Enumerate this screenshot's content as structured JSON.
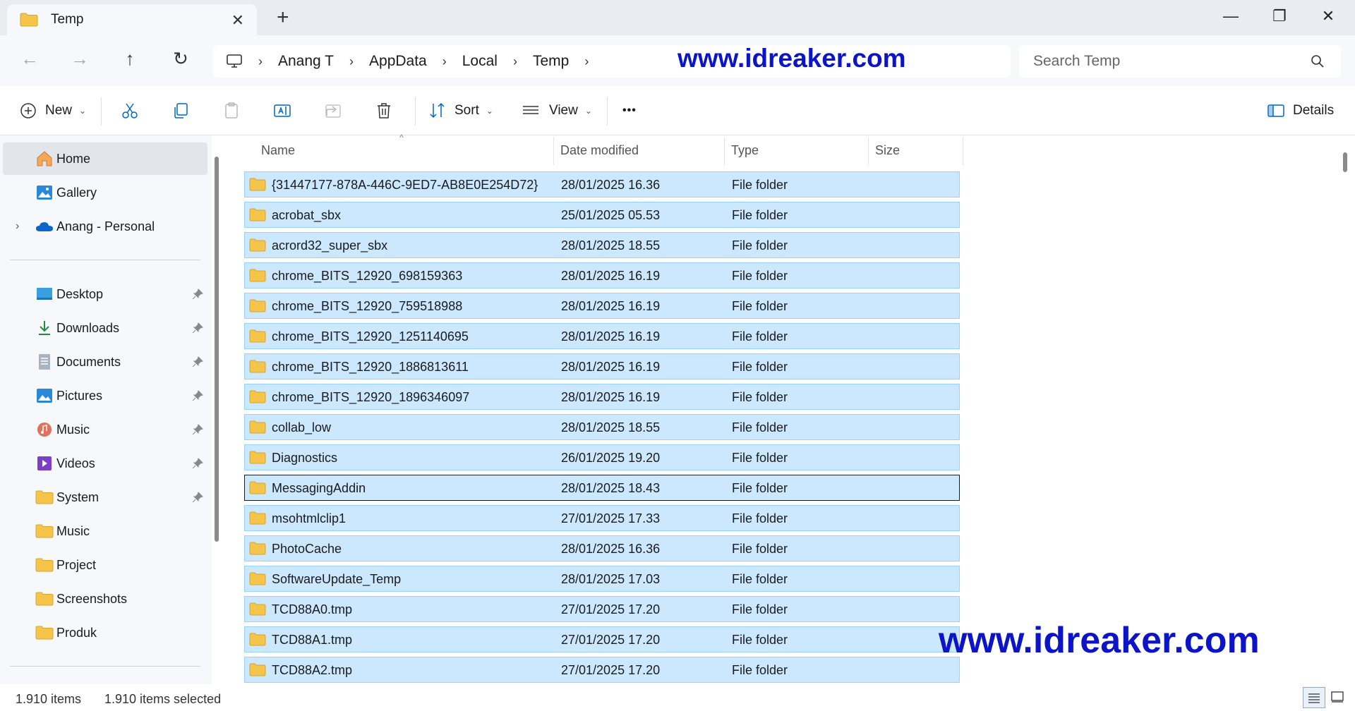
{
  "tab": {
    "title": "Temp",
    "close": "✕",
    "new": "+"
  },
  "window": {
    "minimize": "—",
    "restore": "❐",
    "close": "✕"
  },
  "nav": {
    "back": "←",
    "forward": "→",
    "up": "↑",
    "refresh": "↻"
  },
  "breadcrumb": [
    "Anang T",
    "AppData",
    "Local",
    "Temp"
  ],
  "breadcrumb_sep": "›",
  "watermark": "www.idreaker.com",
  "search": {
    "placeholder": "Search Temp"
  },
  "toolbar": {
    "new_label": "New",
    "sort_label": "Sort",
    "view_label": "View",
    "more_label": "•••",
    "details_label": "Details"
  },
  "sidebar": {
    "top": [
      {
        "label": "Home",
        "icon": "home-icon"
      },
      {
        "label": "Gallery",
        "icon": "gallery-icon"
      },
      {
        "label": "Anang - Personal",
        "icon": "onedrive-icon"
      }
    ],
    "quick": [
      {
        "label": "Desktop",
        "icon": "desktop-icon",
        "pinned": true
      },
      {
        "label": "Downloads",
        "icon": "downloads-icon",
        "pinned": true
      },
      {
        "label": "Documents",
        "icon": "documents-icon",
        "pinned": true
      },
      {
        "label": "Pictures",
        "icon": "pictures-icon",
        "pinned": true
      },
      {
        "label": "Music",
        "icon": "music-icon",
        "pinned": true
      },
      {
        "label": "Videos",
        "icon": "videos-icon",
        "pinned": true
      },
      {
        "label": "System",
        "icon": "folder-icon",
        "pinned": true
      },
      {
        "label": "Music",
        "icon": "folder-icon",
        "pinned": false
      },
      {
        "label": "Project",
        "icon": "folder-icon",
        "pinned": false
      },
      {
        "label": "Screenshots",
        "icon": "folder-icon",
        "pinned": false
      },
      {
        "label": "Produk",
        "icon": "folder-icon",
        "pinned": false
      }
    ]
  },
  "columns": {
    "name": "Name",
    "date": "Date modified",
    "type": "Type",
    "size": "Size"
  },
  "files": [
    {
      "name": "{31447177-878A-446C-9ED7-AB8E0E254D72}",
      "date": "28/01/2025 16.36",
      "type": "File folder"
    },
    {
      "name": "acrobat_sbx",
      "date": "25/01/2025 05.53",
      "type": "File folder"
    },
    {
      "name": "acrord32_super_sbx",
      "date": "28/01/2025 18.55",
      "type": "File folder"
    },
    {
      "name": "chrome_BITS_12920_698159363",
      "date": "28/01/2025 16.19",
      "type": "File folder"
    },
    {
      "name": "chrome_BITS_12920_759518988",
      "date": "28/01/2025 16.19",
      "type": "File folder"
    },
    {
      "name": "chrome_BITS_12920_1251140695",
      "date": "28/01/2025 16.19",
      "type": "File folder"
    },
    {
      "name": "chrome_BITS_12920_1886813611",
      "date": "28/01/2025 16.19",
      "type": "File folder"
    },
    {
      "name": "chrome_BITS_12920_1896346097",
      "date": "28/01/2025 16.19",
      "type": "File folder"
    },
    {
      "name": "collab_low",
      "date": "28/01/2025 18.55",
      "type": "File folder"
    },
    {
      "name": "Diagnostics",
      "date": "26/01/2025 19.20",
      "type": "File folder"
    },
    {
      "name": "MessagingAddin",
      "date": "28/01/2025 18.43",
      "type": "File folder",
      "focused": true
    },
    {
      "name": "msohtmlclip1",
      "date": "27/01/2025 17.33",
      "type": "File folder"
    },
    {
      "name": "PhotoCache",
      "date": "28/01/2025 16.36",
      "type": "File folder"
    },
    {
      "name": "SoftwareUpdate_Temp",
      "date": "28/01/2025 17.03",
      "type": "File folder"
    },
    {
      "name": "TCD88A0.tmp",
      "date": "27/01/2025 17.20",
      "type": "File folder"
    },
    {
      "name": "TCD88A1.tmp",
      "date": "27/01/2025 17.20",
      "type": "File folder"
    },
    {
      "name": "TCD88A2.tmp",
      "date": "27/01/2025 17.20",
      "type": "File folder"
    }
  ],
  "status": {
    "count": "1.910 items",
    "selected": "1.910 items selected"
  },
  "colors": {
    "selection": "#cce8ff",
    "selection_border": "#99d1ff",
    "watermark": "#0b14c8",
    "folder": "#f4c54a"
  }
}
